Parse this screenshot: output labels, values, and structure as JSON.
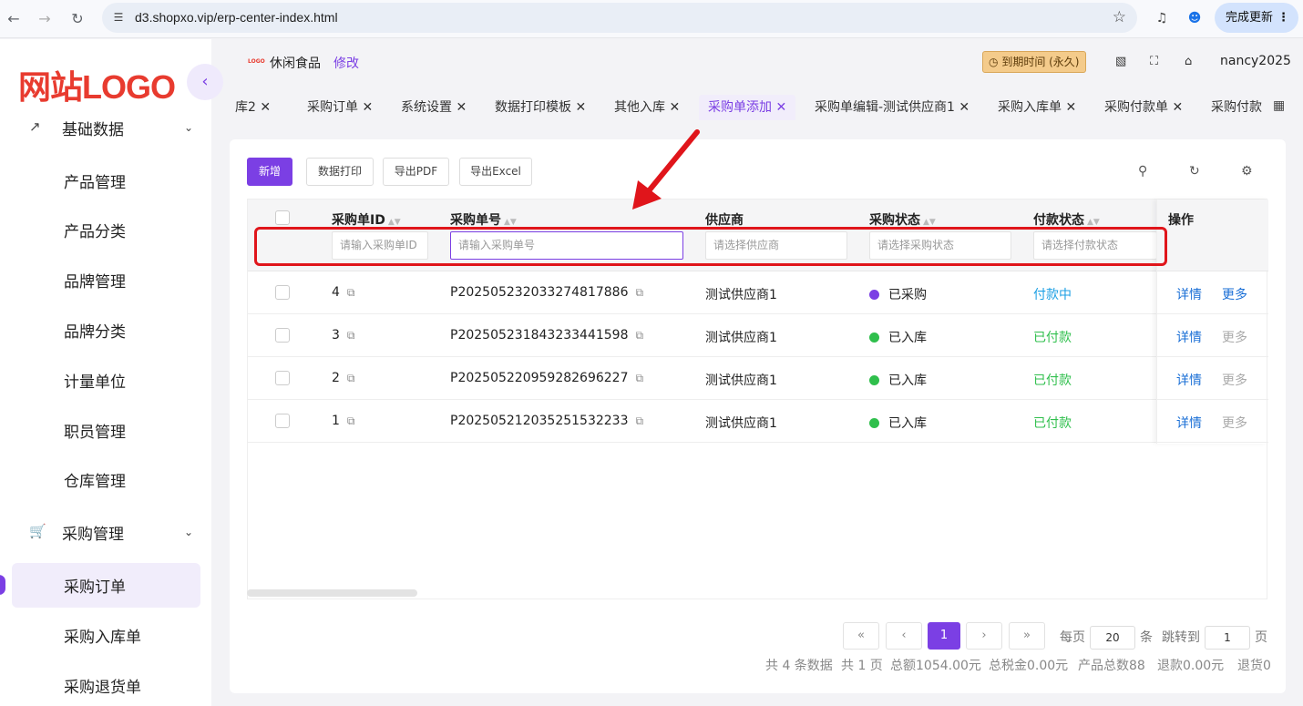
{
  "browser": {
    "url": "d3.shopxo.vip/erp-center-index.html",
    "update_button": "完成更新"
  },
  "sidebar": {
    "logo": "网站LOGO",
    "groups": [
      {
        "label": "基础数据",
        "items": [
          "产品管理",
          "产品分类",
          "品牌管理",
          "品牌分类",
          "计量单位",
          "职员管理",
          "仓库管理"
        ]
      },
      {
        "label": "采购管理",
        "items": [
          "采购订单",
          "采购入库单",
          "采购退货单"
        ]
      }
    ]
  },
  "header": {
    "shop_logo": "LOGO",
    "shop_name": "休闲食品",
    "edit": "修改",
    "expire": "到期时间 (永久)",
    "username": "nancy2025"
  },
  "tabs": [
    "库2",
    "采购订单",
    "系统设置",
    "数据打印模板",
    "其他入库",
    "采购单添加",
    "采购单编辑-测试供应商1",
    "采购入库单",
    "采购付款单",
    "采购付款"
  ],
  "active_tab": "采购单添加",
  "toolbar": {
    "add": "新增",
    "print": "数据打印",
    "pdf": "导出PDF",
    "excel": "导出Excel"
  },
  "table": {
    "headers": [
      "采购单ID",
      "采购单号",
      "供应商",
      "采购状态",
      "付款状态",
      "操作"
    ],
    "filters": [
      "请输入采购单ID",
      "请输入采购单号",
      "请选择供应商",
      "请选择采购状态",
      "请选择付款状态"
    ],
    "rows": [
      {
        "id": "4",
        "no": "P202505232033274817886",
        "supplier": "测试供应商1",
        "status": "已采购",
        "status_color": "#7b3fe4",
        "pay": "付款中",
        "pay_color": "#1c9fe4",
        "detail": "详情",
        "more": "更多"
      },
      {
        "id": "3",
        "no": "P202505231843233441598",
        "supplier": "测试供应商1",
        "status": "已入库",
        "status_color": "#2fbf4c",
        "pay": "已付款",
        "pay_color": "#2fbf4c",
        "detail": "详情",
        "more": "更多"
      },
      {
        "id": "2",
        "no": "P202505220959282696227",
        "supplier": "测试供应商1",
        "status": "已入库",
        "status_color": "#2fbf4c",
        "pay": "已付款",
        "pay_color": "#2fbf4c",
        "detail": "详情",
        "more": "更多"
      },
      {
        "id": "1",
        "no": "P202505212035251532233",
        "supplier": "测试供应商1",
        "status": "已入库",
        "status_color": "#2fbf4c",
        "pay": "已付款",
        "pay_color": "#2fbf4c",
        "detail": "详情",
        "more": "更多"
      }
    ]
  },
  "pagination": {
    "current": "1",
    "per_page_label": "每页",
    "per_page": "20",
    "per_page_unit": "条",
    "jump_label": "跳转到",
    "jump_value": "1",
    "jump_unit": "页",
    "summary": [
      "共 4 条数据",
      "共 1 页",
      "总额1054.00元",
      "总税金0.00元",
      "产品总数88",
      "退款0.00元",
      "退货0"
    ]
  },
  "colors": {
    "accent": "#7b3fe4",
    "annotation": "#e0151b"
  }
}
